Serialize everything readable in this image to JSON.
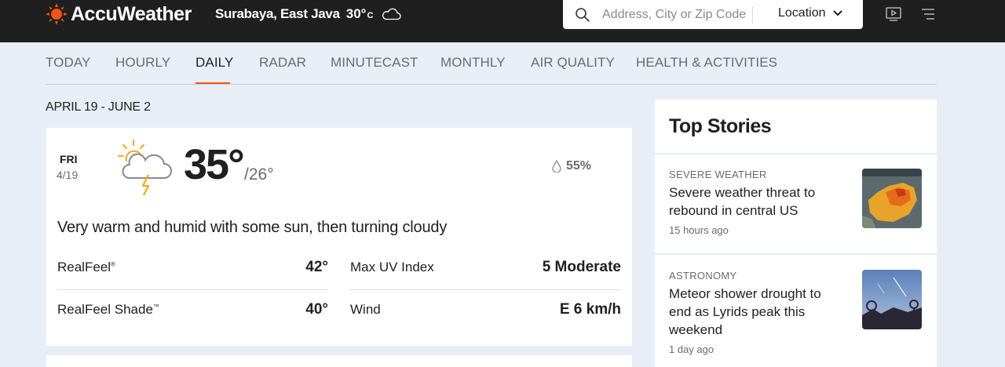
{
  "header": {
    "brand": "AccuWeather",
    "current_city": "Surabaya, East Java",
    "current_temp": "30°",
    "current_unit": "C",
    "current_icon": "cloudy-icon",
    "search_placeholder": "Address, City or Zip Code",
    "location_label": "Location"
  },
  "nav": {
    "tabs": [
      {
        "label": "TODAY"
      },
      {
        "label": "HOURLY"
      },
      {
        "label": "DAILY",
        "active": true
      },
      {
        "label": "RADAR"
      },
      {
        "label": "MINUTECAST"
      },
      {
        "label": "MONTHLY"
      },
      {
        "label": "AIR QUALITY"
      },
      {
        "label": "HEALTH & ACTIVITIES"
      }
    ]
  },
  "forecast": {
    "date_range": "APRIL 19 - JUNE 2",
    "day": "FRI",
    "date": "4/19",
    "icon": "partly-sunny-thunderstorm-icon",
    "high": "35°",
    "low": "/26°",
    "precip": "55%",
    "phrase": "Very warm and humid with some sun, then turning cloudy",
    "details": [
      {
        "label": "RealFeel",
        "mark": "®",
        "value": "42°"
      },
      {
        "label": "Max UV Index",
        "value": "5 Moderate"
      },
      {
        "label": "RealFeel Shade",
        "mark": "™",
        "value": "40°"
      },
      {
        "label": "Wind",
        "value": "E 6 km/h"
      }
    ]
  },
  "top_stories": {
    "title": "Top Stories",
    "items": [
      {
        "category": "SEVERE WEATHER",
        "title": "Severe weather threat to rebound in central US",
        "time": "15 hours ago"
      },
      {
        "category": "ASTRONOMY",
        "title": "Meteor shower drought to end as Lyrids peak this weekend",
        "time": "1 day ago"
      }
    ]
  },
  "colors": {
    "accent": "#f05514",
    "header_bg": "#1f1f1f",
    "page_bg": "#e9eef6"
  }
}
